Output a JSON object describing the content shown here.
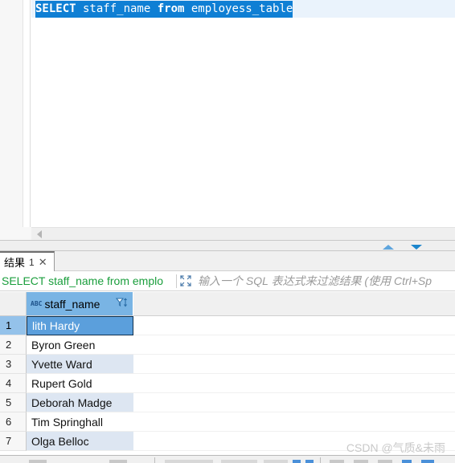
{
  "editor": {
    "selected_sql": {
      "kw_select": "SELECT",
      "col": " staff_name ",
      "kw_from": "from",
      "table": " employess_table"
    },
    "full_text": "SELECT staff_name from employess_table"
  },
  "splitter": {
    "up_arrow_name": "scroll-up",
    "down_arrow_name": "scroll-down"
  },
  "results_tabs": [
    {
      "label": "结果",
      "number": "1",
      "close": "✕"
    }
  ],
  "filter_bar": {
    "query_text": "SELECT staff_name from emplo",
    "expand_icon": "maximize-icon",
    "placeholder": "输入一个 SQL 表达式来过滤结果 (使用 Ctrl+Sp"
  },
  "grid": {
    "columns": [
      {
        "name": "staff_name",
        "type_icon": "ABC",
        "sort_filter_icon": "filter-sort-icon"
      }
    ],
    "rows": [
      {
        "num": "1",
        "staff_name": "lith Hardy"
      },
      {
        "num": "2",
        "staff_name": "Byron Green"
      },
      {
        "num": "3",
        "staff_name": "Yvette Ward"
      },
      {
        "num": "4",
        "staff_name": "Rupert Gold"
      },
      {
        "num": "5",
        "staff_name": "Deborah Madge"
      },
      {
        "num": "6",
        "staff_name": "Tim Springhall"
      },
      {
        "num": "7",
        "staff_name": "Olga Belloc"
      }
    ]
  },
  "watermark": {
    "text": "CSDN @气质&未雨"
  },
  "colors": {
    "selection_blue": "#0f7fd4",
    "header_blue": "#79b4e4",
    "row_selected_blue": "#5b9fdc",
    "alt_row": "#dde6f2",
    "query_green": "#1a9e3c"
  }
}
